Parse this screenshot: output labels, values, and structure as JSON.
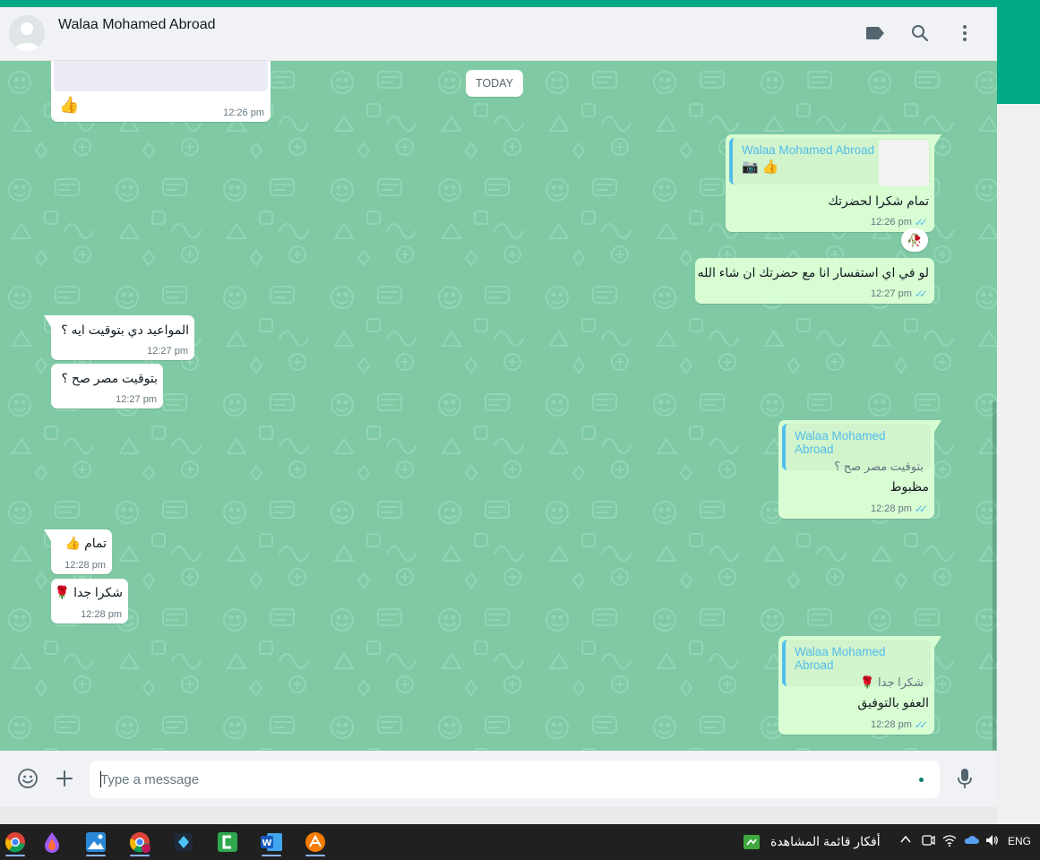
{
  "header": {
    "contact_name": "Walaa Mohamed Abroad"
  },
  "chat": {
    "date_separator": "TODAY",
    "messages": [
      {
        "dir": "in",
        "text": "👍",
        "time": "12:26 pm"
      },
      {
        "dir": "out",
        "quote_name": "Walaa Mohamed Abroad",
        "quote_text": "📷 👍",
        "text": "تمام شكرا لحضرتك",
        "time": "12:26 pm",
        "reaction": "🥀"
      },
      {
        "dir": "out",
        "text": "لو في اي استفسار انا مع حضرتك ان شاء الله",
        "time": "12:27 pm"
      },
      {
        "dir": "in",
        "text": "المواعيد دي بتوقيت ايه ؟",
        "time": "12:27 pm"
      },
      {
        "dir": "in",
        "text": "بتوقيت مصر صح ؟",
        "time": "12:27 pm"
      },
      {
        "dir": "out",
        "quote_name": "Walaa Mohamed Abroad",
        "quote_text": "بتوقيت مصر صح ؟",
        "text": "مظبوط",
        "time": "12:28 pm"
      },
      {
        "dir": "in",
        "text": "تمام 👍",
        "time": "12:28 pm"
      },
      {
        "dir": "in",
        "text": "شكرا جدا 🌹",
        "time": "12:28 pm"
      },
      {
        "dir": "out",
        "quote_name": "Walaa Mohamed Abroad",
        "quote_text": "شكرا جدا 🌹",
        "text": "العفو بالتوفيق",
        "time": "12:28 pm"
      }
    ]
  },
  "composer": {
    "placeholder": "Type a message"
  },
  "taskbar": {
    "widget_text": "أفكار قائمة المشاهدة",
    "language": "ENG"
  },
  "colors": {
    "accent": "#00a884",
    "wallpaper": "#7fcaa5",
    "outgoing_bubble": "#d9fdd3",
    "quote_name": "#53bdeb",
    "read_ticks": "#53bdeb"
  }
}
